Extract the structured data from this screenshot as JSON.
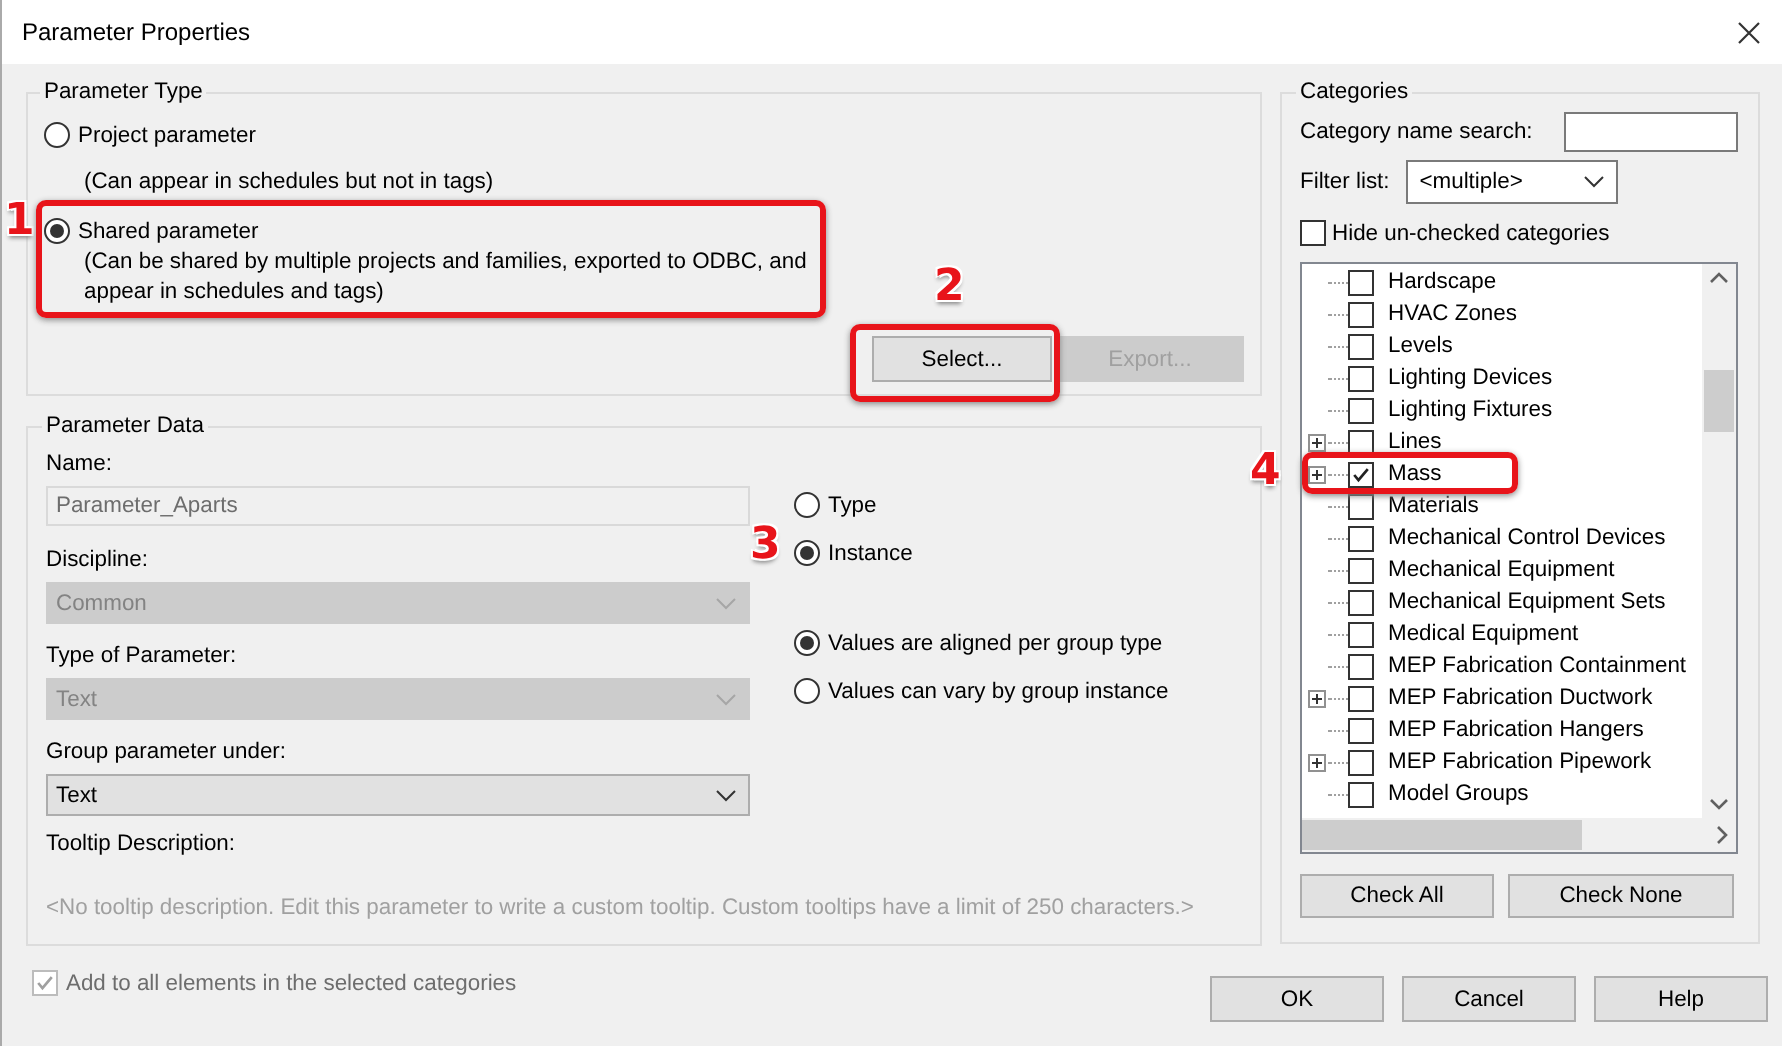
{
  "window": {
    "title": "Parameter Properties"
  },
  "parameter_type": {
    "title": "Parameter Type",
    "options": [
      {
        "label": "Project parameter",
        "description": "(Can appear in schedules but not in tags)",
        "selected": false
      },
      {
        "label": "Shared parameter",
        "description": "(Can be shared by multiple projects and families, exported to ODBC, and appear in schedules and tags)",
        "selected": true
      }
    ],
    "buttons": [
      {
        "label": "Select...",
        "disabled": false
      },
      {
        "label": "Export...",
        "disabled": true
      }
    ]
  },
  "parameter_data": {
    "title": "Parameter Data",
    "fields": [
      {
        "kind": "text",
        "label": "Name:",
        "value": "Parameter_Aparts",
        "disabled": true
      },
      {
        "kind": "combo",
        "label": "Discipline:",
        "value": "Common",
        "disabled": true
      },
      {
        "kind": "combo",
        "label": "Type of Parameter:",
        "value": "Text",
        "disabled": true
      },
      {
        "kind": "combo",
        "label": "Group parameter under:",
        "value": "Text",
        "disabled": false
      }
    ],
    "tooltip": {
      "label": "Tooltip Description:",
      "text": "<No tooltip description. Edit this parameter to write a custom tooltip. Custom tooltips have a limit of 250 characters.>"
    },
    "scope_options": [
      {
        "label": "Type",
        "selected": false
      },
      {
        "label": "Instance",
        "selected": true
      }
    ],
    "group_options": [
      {
        "label": "Values are aligned per group type",
        "selected": true
      },
      {
        "label": "Values can vary by group instance",
        "selected": false
      }
    ]
  },
  "categories": {
    "title": "Categories",
    "search": {
      "label": "Category name search:"
    },
    "filter": {
      "label": "Filter list:",
      "value": "<multiple>"
    },
    "hide_unchecked": {
      "label": "Hide un-checked categories",
      "checked": false
    },
    "items": [
      {
        "label": "Hardscape",
        "checked": false,
        "expandable": false
      },
      {
        "label": "HVAC Zones",
        "checked": false,
        "expandable": false
      },
      {
        "label": "Levels",
        "checked": false,
        "expandable": false
      },
      {
        "label": "Lighting Devices",
        "checked": false,
        "expandable": false
      },
      {
        "label": "Lighting Fixtures",
        "checked": false,
        "expandable": false
      },
      {
        "label": "Lines",
        "checked": false,
        "expandable": true
      },
      {
        "label": "Mass",
        "checked": true,
        "expandable": true
      },
      {
        "label": "Materials",
        "checked": false,
        "expandable": false
      },
      {
        "label": "Mechanical Control Devices",
        "checked": false,
        "expandable": false
      },
      {
        "label": "Mechanical Equipment",
        "checked": false,
        "expandable": false
      },
      {
        "label": "Mechanical Equipment Sets",
        "checked": false,
        "expandable": false
      },
      {
        "label": "Medical Equipment",
        "checked": false,
        "expandable": false
      },
      {
        "label": "MEP Fabrication Containment",
        "checked": false,
        "expandable": false
      },
      {
        "label": "MEP Fabrication Ductwork",
        "checked": false,
        "expandable": true
      },
      {
        "label": "MEP Fabrication Hangers",
        "checked": false,
        "expandable": false
      },
      {
        "label": "MEP Fabrication Pipework",
        "checked": false,
        "expandable": true
      },
      {
        "label": "Model Groups",
        "checked": false,
        "expandable": false
      }
    ],
    "buttons": [
      "Check All",
      "Check None"
    ]
  },
  "add_to_all": {
    "label": "Add to all elements in the selected categories",
    "checked": true,
    "disabled": true
  },
  "buttons": [
    "OK",
    "Cancel",
    "Help"
  ],
  "annotations": [
    {
      "number": "1"
    },
    {
      "number": "2"
    },
    {
      "number": "3"
    },
    {
      "number": "4"
    }
  ]
}
